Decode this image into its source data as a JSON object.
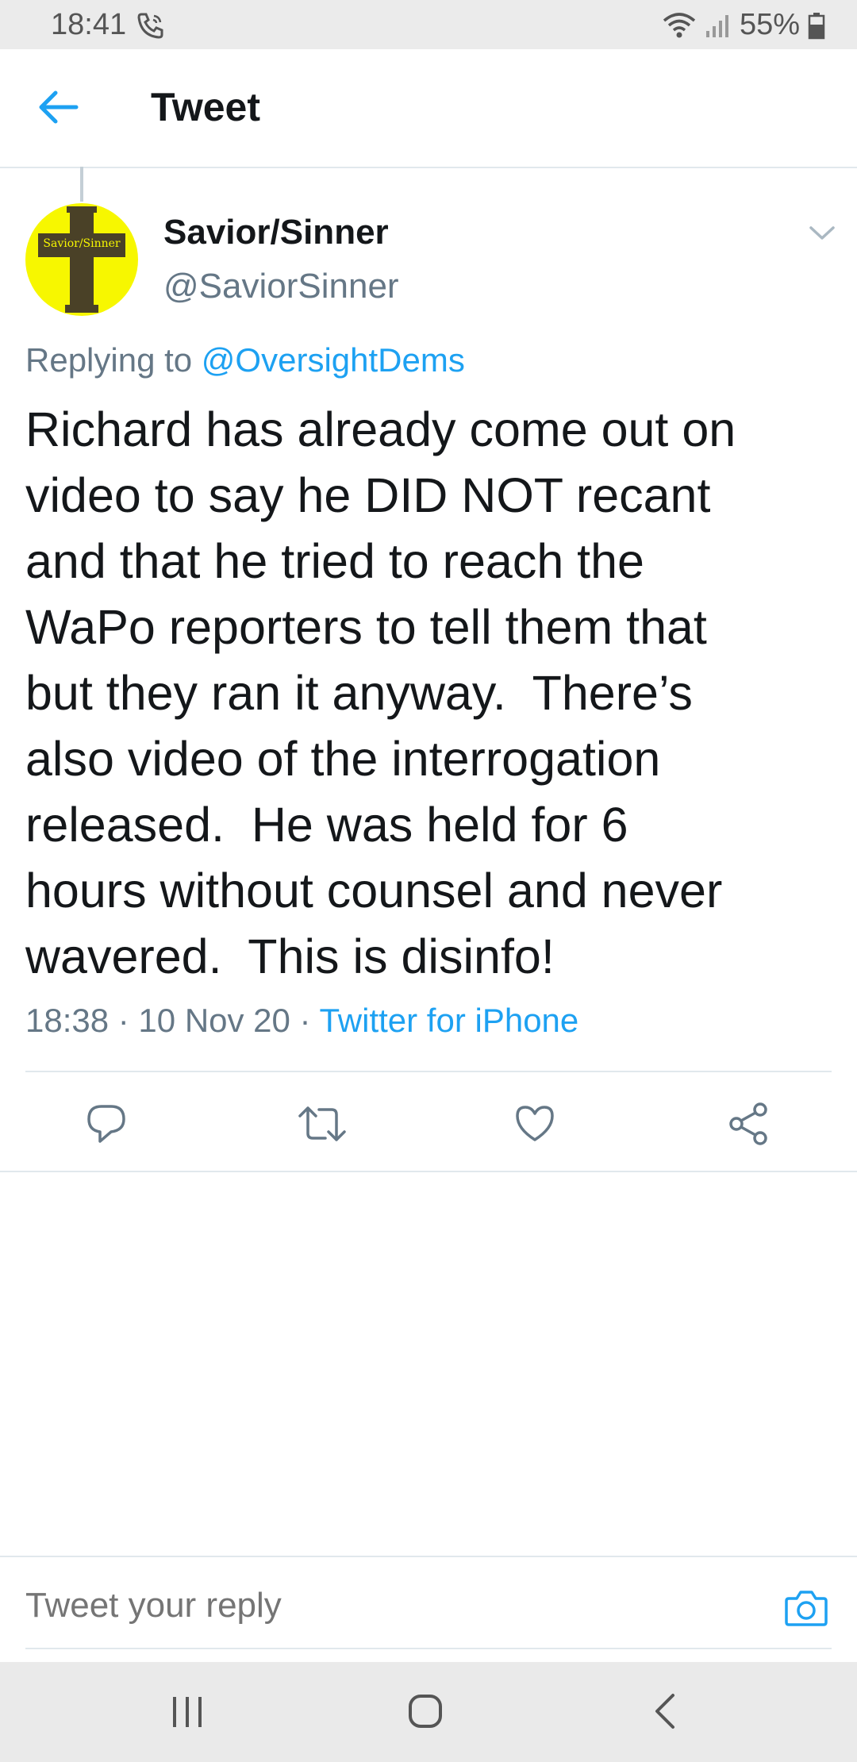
{
  "status_bar": {
    "time": "18:41",
    "battery": "55%"
  },
  "header": {
    "title": "Tweet"
  },
  "tweet": {
    "author_name": "Savior/Sinner",
    "author_handle": "@SaviorSinner",
    "avatar_text": "Savior/Sinner",
    "replying_to_label": "Replying to",
    "replying_to_handle": "@OversightDems",
    "text_lines": [
      "Richard has already come out on",
      "video to say he DID NOT recant",
      "and that he tried to reach the",
      "WaPo reporters to tell them that",
      "but they ran it anyway.  There’s",
      "also video of the interrogation",
      "released.  He was held for 6",
      "hours without counsel and never",
      "wavered.  This is disinfo!"
    ],
    "timestamp": "18:38 · 10 Nov 20 · ",
    "source": "Twitter for iPhone"
  },
  "actions": {
    "icons": [
      "reply-icon",
      "retweet-icon",
      "like-icon",
      "share-icon"
    ]
  },
  "reply": {
    "placeholder": "Tweet your reply"
  },
  "colors": {
    "accent": "#1da1f2",
    "secondary_text": "#657786",
    "avatar_bg": "#f7f700"
  }
}
